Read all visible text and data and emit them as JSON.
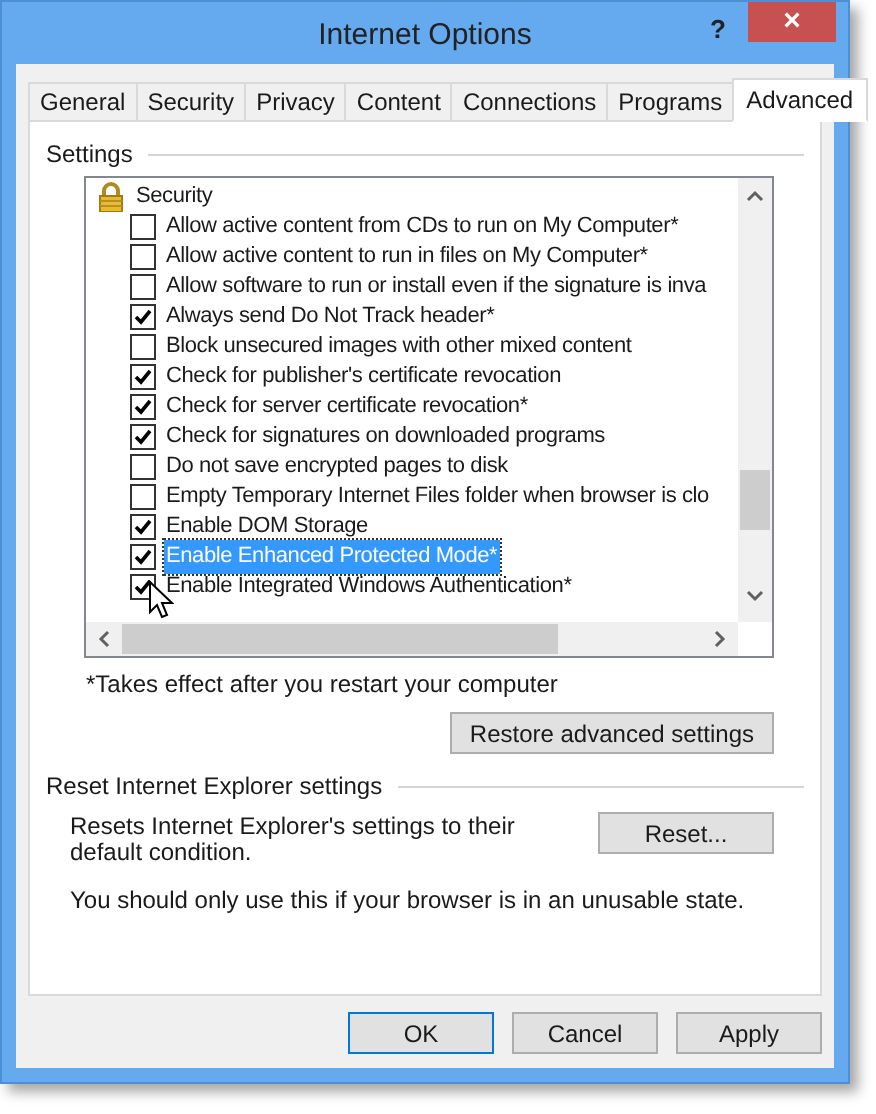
{
  "window": {
    "title": "Internet Options",
    "help": "?",
    "close": "×"
  },
  "tabs": [
    {
      "label": "General",
      "selected": false
    },
    {
      "label": "Security",
      "selected": false
    },
    {
      "label": "Privacy",
      "selected": false
    },
    {
      "label": "Content",
      "selected": false
    },
    {
      "label": "Connections",
      "selected": false
    },
    {
      "label": "Programs",
      "selected": false
    },
    {
      "label": "Advanced",
      "selected": true
    }
  ],
  "settings": {
    "label": "Settings",
    "items": [
      {
        "kind": "header",
        "label": "Security"
      },
      {
        "kind": "checkbox",
        "label": "Allow active content from CDs to run on My Computer*",
        "checked": false,
        "selected": false
      },
      {
        "kind": "checkbox",
        "label": "Allow active content to run in files on My Computer*",
        "checked": false,
        "selected": false
      },
      {
        "kind": "checkbox",
        "label": "Allow software to run or install even if the signature is inva",
        "checked": false,
        "selected": false
      },
      {
        "kind": "checkbox",
        "label": "Always send Do Not Track header*",
        "checked": true,
        "selected": false
      },
      {
        "kind": "checkbox",
        "label": "Block unsecured images with other mixed content",
        "checked": false,
        "selected": false
      },
      {
        "kind": "checkbox",
        "label": "Check for publisher's certificate revocation",
        "checked": true,
        "selected": false
      },
      {
        "kind": "checkbox",
        "label": "Check for server certificate revocation*",
        "checked": true,
        "selected": false
      },
      {
        "kind": "checkbox",
        "label": "Check for signatures on downloaded programs",
        "checked": true,
        "selected": false
      },
      {
        "kind": "checkbox",
        "label": "Do not save encrypted pages to disk",
        "checked": false,
        "selected": false
      },
      {
        "kind": "checkbox",
        "label": "Empty Temporary Internet Files folder when browser is clo",
        "checked": false,
        "selected": false
      },
      {
        "kind": "checkbox",
        "label": "Enable DOM Storage",
        "checked": true,
        "selected": false
      },
      {
        "kind": "checkbox",
        "label": "Enable Enhanced Protected Mode*",
        "checked": true,
        "selected": true
      },
      {
        "kind": "checkbox",
        "label": "Enable Integrated Windows Authentication*",
        "checked": true,
        "selected": false
      }
    ],
    "footnote": "*Takes effect after you restart your computer",
    "restore_button": "Restore advanced settings"
  },
  "reset": {
    "label": "Reset Internet Explorer settings",
    "description": "Resets Internet Explorer's settings to their default condition.",
    "button": "Reset...",
    "note": "You should only use this if your browser is in an unusable state."
  },
  "buttons": [
    {
      "label": "OK",
      "default": true
    },
    {
      "label": "Cancel",
      "default": false
    },
    {
      "label": "Apply",
      "default": false
    }
  ]
}
